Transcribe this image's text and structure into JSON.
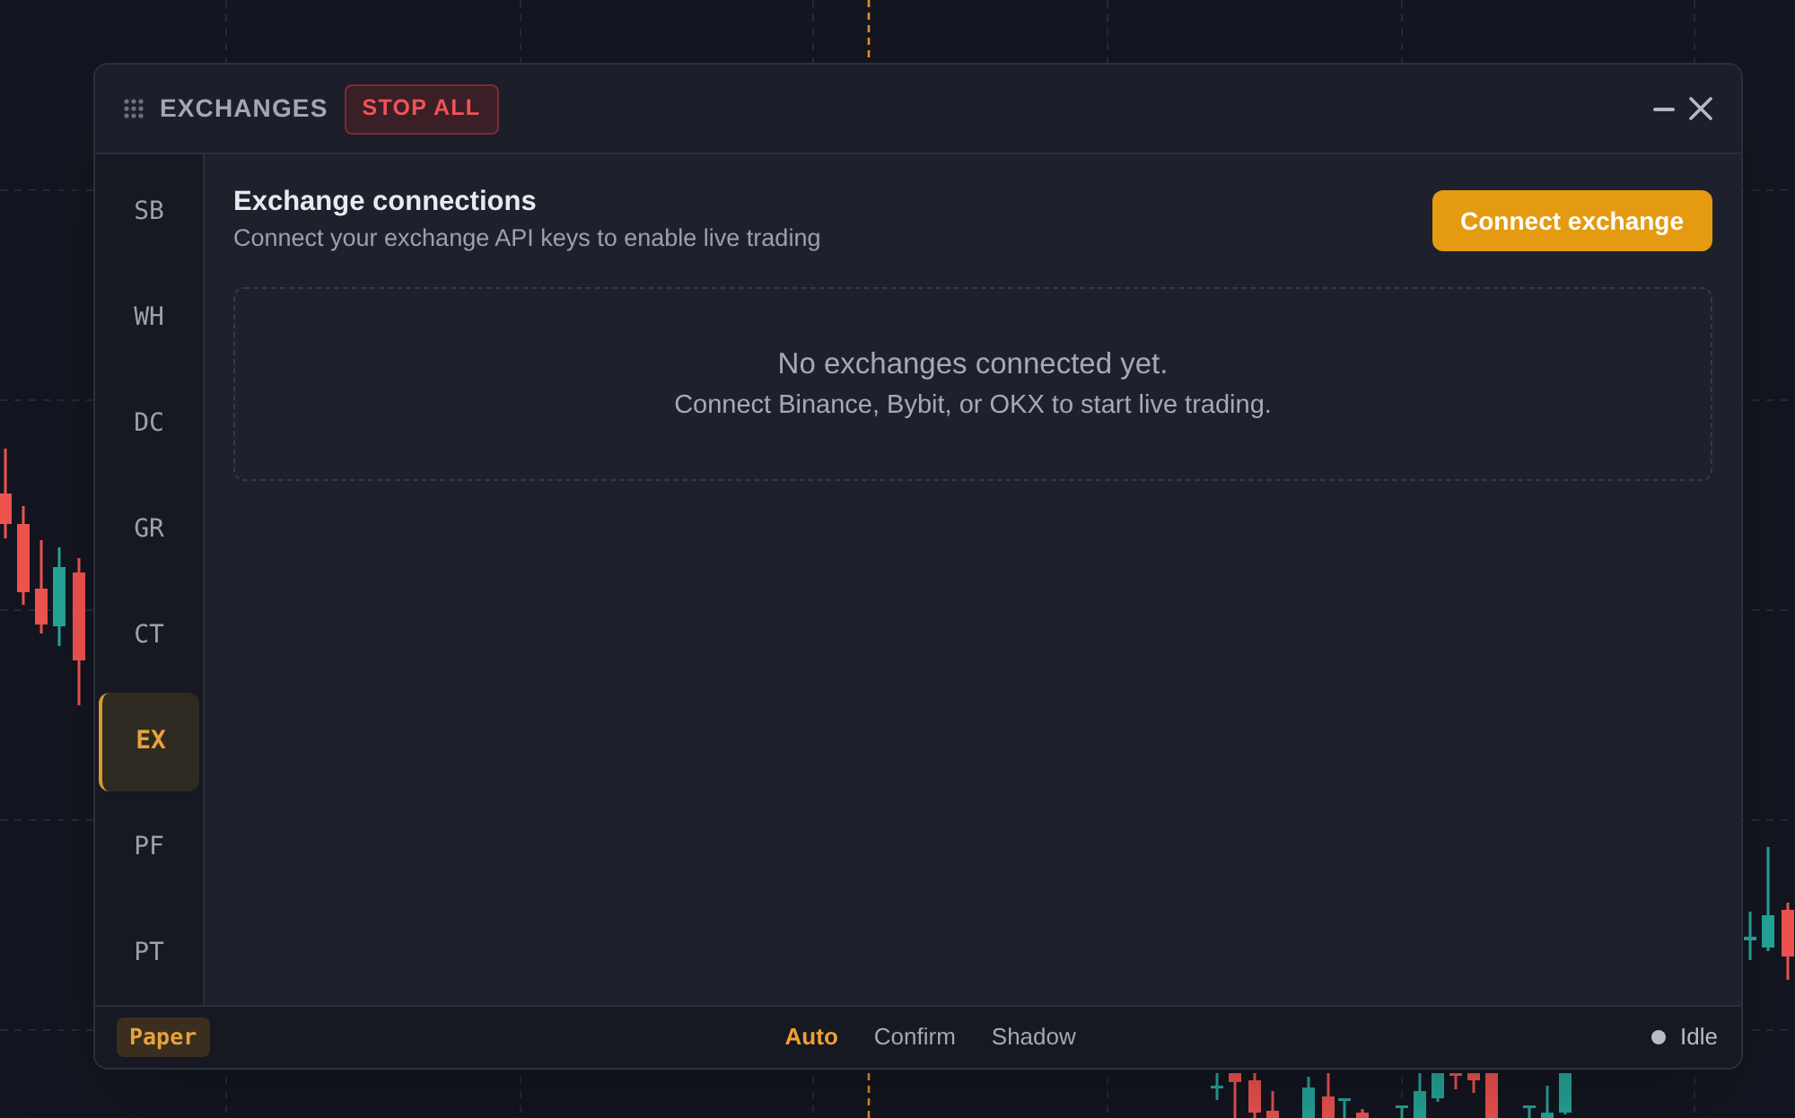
{
  "panel": {
    "title": "EXCHANGES",
    "stop_button": "STOP ALL"
  },
  "sidebar": {
    "items": [
      {
        "label": "SB",
        "selected": false
      },
      {
        "label": "WH",
        "selected": false
      },
      {
        "label": "DC",
        "selected": false
      },
      {
        "label": "GR",
        "selected": false
      },
      {
        "label": "CT",
        "selected": false
      },
      {
        "label": "EX",
        "selected": true
      },
      {
        "label": "PF",
        "selected": false
      },
      {
        "label": "PT",
        "selected": false
      }
    ]
  },
  "content": {
    "heading": "Exchange connections",
    "subtitle": "Connect your exchange API keys to enable live trading",
    "action_button": "Connect exchange",
    "empty_state": {
      "title": "No exchanges connected yet.",
      "message": "Connect Binance, Bybit, or OKX to start live trading."
    }
  },
  "footer": {
    "mode_badge": "Paper",
    "modes": [
      {
        "label": "Auto",
        "selected": true
      },
      {
        "label": "Confirm",
        "selected": false
      },
      {
        "label": "Shadow",
        "selected": false
      }
    ],
    "status": "Idle"
  }
}
